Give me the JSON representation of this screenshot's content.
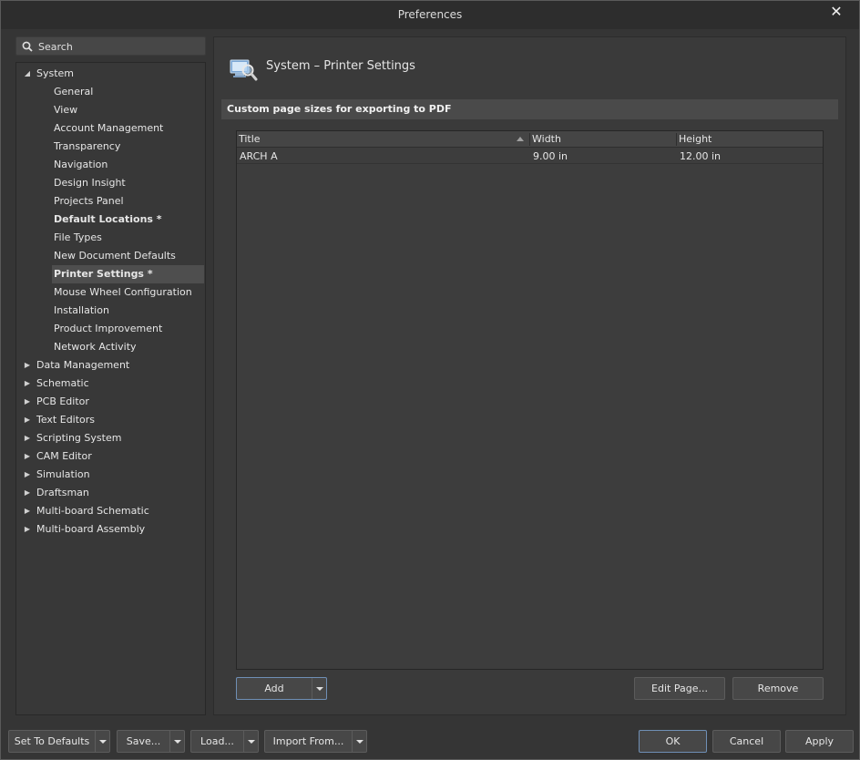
{
  "window": {
    "title": "Preferences"
  },
  "search": {
    "placeholder": "Search"
  },
  "tree": {
    "system": {
      "label": "System",
      "children": [
        {
          "label": "General"
        },
        {
          "label": "View"
        },
        {
          "label": "Account Management"
        },
        {
          "label": "Transparency"
        },
        {
          "label": "Navigation"
        },
        {
          "label": "Design Insight"
        },
        {
          "label": "Projects Panel"
        },
        {
          "label": "Default Locations *"
        },
        {
          "label": "File Types"
        },
        {
          "label": "New Document Defaults"
        },
        {
          "label": "Printer Settings *"
        },
        {
          "label": "Mouse Wheel Configuration"
        },
        {
          "label": "Installation"
        },
        {
          "label": "Product Improvement"
        },
        {
          "label": "Network Activity"
        }
      ]
    },
    "groups": [
      {
        "label": "Data Management"
      },
      {
        "label": "Schematic"
      },
      {
        "label": "PCB Editor"
      },
      {
        "label": "Text Editors"
      },
      {
        "label": "Scripting System"
      },
      {
        "label": "CAM Editor"
      },
      {
        "label": "Simulation"
      },
      {
        "label": "Draftsman"
      },
      {
        "label": "Multi-board Schematic"
      },
      {
        "label": "Multi-board Assembly"
      }
    ]
  },
  "content": {
    "page_title": "System – Printer Settings",
    "section_title": "Custom page sizes for exporting to PDF",
    "table": {
      "columns": [
        "Title",
        "Width",
        "Height"
      ],
      "rows": [
        {
          "title": "ARCH A",
          "width": "9.00 in",
          "height": "12.00 in"
        }
      ]
    },
    "buttons": {
      "add": "Add",
      "edit_page": "Edit Page...",
      "remove": "Remove"
    }
  },
  "footer": {
    "set_to_defaults": "Set To Defaults",
    "save": "Save...",
    "load": "Load...",
    "import_from": "Import From...",
    "ok": "OK",
    "cancel": "Cancel",
    "apply": "Apply"
  }
}
